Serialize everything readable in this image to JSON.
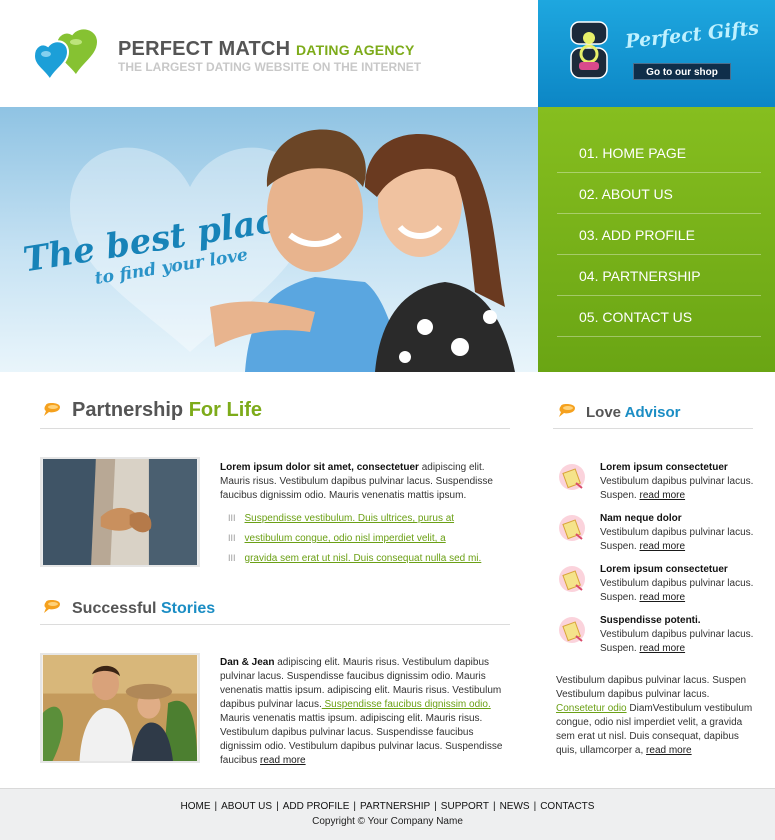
{
  "header": {
    "brand_main": "PERFECT MATCH",
    "brand_accent": "DATING AGENCY",
    "subtitle": "THE LARGEST DATING WEBSITE ON THE INTERNET",
    "gifts_title": "Perfect Gifts",
    "shop_button": "Go to our shop"
  },
  "hero": {
    "tagline_line1": "The best place",
    "tagline_line2": "to find your love"
  },
  "nav": {
    "items": [
      {
        "label": "01. HOME PAGE"
      },
      {
        "label": "02. ABOUT US"
      },
      {
        "label": "03. ADD PROFILE"
      },
      {
        "label": "04. PARTNERSHIP"
      },
      {
        "label": "05. CONTACT US"
      }
    ]
  },
  "partnership": {
    "title_main": "Partnership ",
    "title_accent": "For Life",
    "intro_bold": "Lorem ipsum dolor sit amet, consectetuer",
    "intro_rest": " adipiscing elit. Mauris risus. Vestibulum dapibus pulvinar lacus. Suspendisse faucibus dignissim odio. Mauris venenatis mattis ipsum.",
    "bullet_mark": "III",
    "links": [
      "Suspendisse vestibulum. Duis ultrices, purus at",
      "vestibulum congue, odio nisl imperdiet velit, a",
      "gravida sem erat ut nisl. Duis consequat nulla sed mi."
    ]
  },
  "stories": {
    "title_main": "Successful ",
    "title_accent": "Stories",
    "names": "Dan & Jean",
    "text_a": " adipiscing elit. Mauris risus. Vestibulum dapibus pulvinar lacus. Suspendisse faucibus dignissim odio. Mauris venenatis mattis ipsum. adipiscing elit. Mauris risus. Vestibulum dapibus pulvinar lacus.",
    "link": " Suspendisse faucibus dignissim odio.",
    "text_b": " Mauris venenatis mattis ipsum. adipiscing elit. Mauris risus. Vestibulum dapibus pulvinar lacus. Suspendisse faucibus dignissim odio. Vestibulum dapibus pulvinar lacus. Suspendisse faucibus ",
    "read_more": "read more"
  },
  "advisor": {
    "title_main": "Love ",
    "title_accent": "Advisor",
    "items": [
      {
        "title": "Lorem ipsum consectetuer",
        "text": "Vestibulum dapibus pulvinar lacus. Suspen.",
        "read_more": "read more"
      },
      {
        "title": "Nam neque dolor",
        "text": "Vestibulum dapibus pulvinar lacus. Suspen.",
        "read_more": "read more"
      },
      {
        "title": "Lorem ipsum consectetuer",
        "text": "Vestibulum dapibus pulvinar lacus. Suspen.",
        "read_more": "read more"
      },
      {
        "title": "Suspendisse potenti.",
        "text": "Vestibulum dapibus pulvinar lacus. Suspen.",
        "read_more": "read more"
      }
    ],
    "bottom_text_a": "Vestibulum dapibus pulvinar lacus. Suspen Vestibulum dapibus pulvinar lacus.",
    "bottom_link": "Consetetur odio",
    "bottom_text_b": " DiamVestibulum vestibulum congue, odio nisl imperdiet velit, a gravida sem erat ut nisl. Duis consequat, dapibus quis, ullamcorper a,",
    "bottom_read_more": "read more"
  },
  "footer": {
    "links": [
      "HOME",
      "ABOUT US",
      "ADD PROFILE",
      "PARTNERSHIP",
      "SUPPORT",
      "NEWS",
      "CONTACTS"
    ],
    "copyright": "Copyright © Your Company Name"
  },
  "colors": {
    "green_accent": "#7dab1a",
    "blue_accent": "#1b8dc4",
    "nav_green": "#78b21a",
    "gifts_blue": "#1497d5"
  }
}
